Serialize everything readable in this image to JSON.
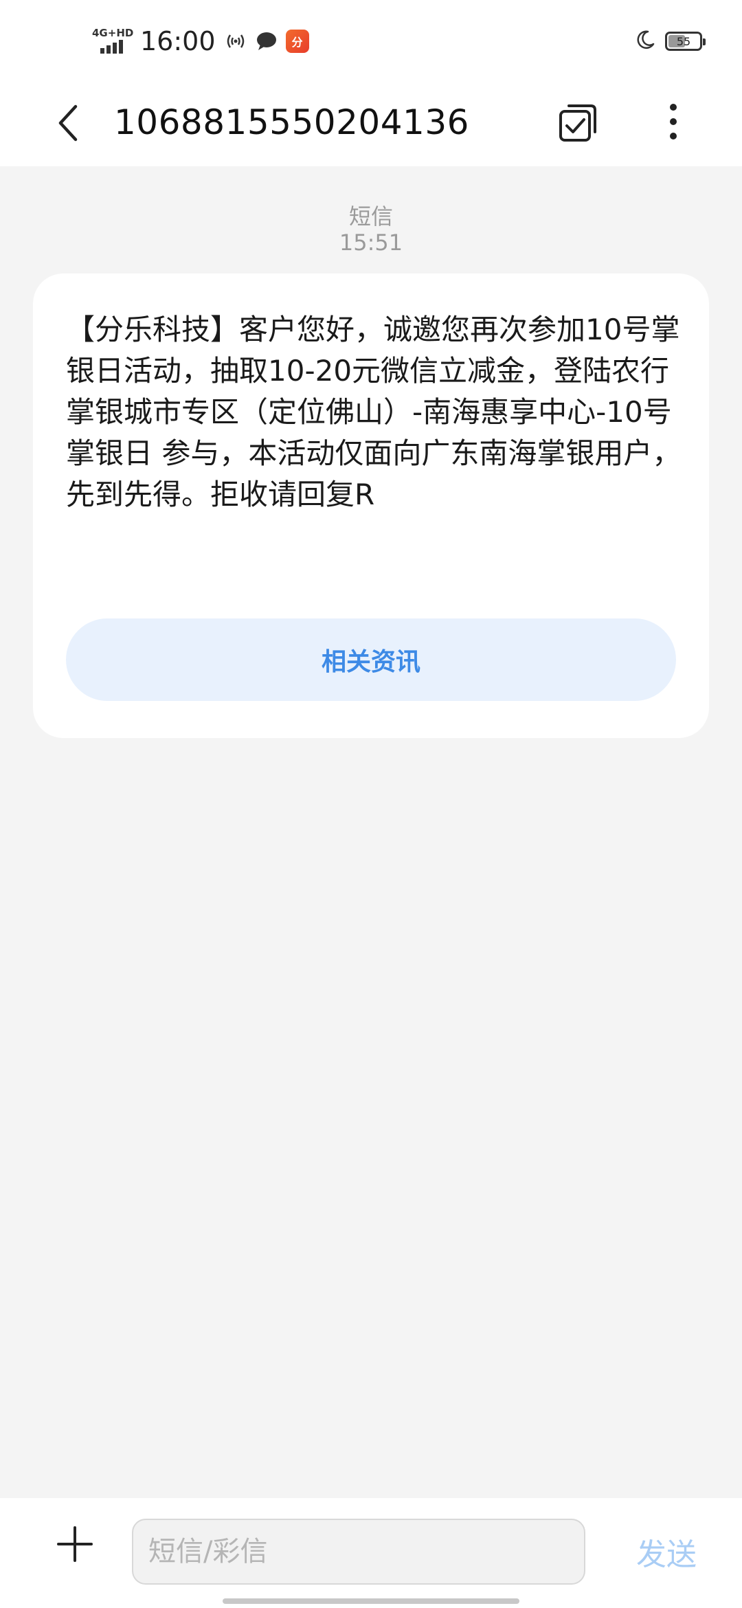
{
  "status_bar": {
    "network": "4G+HD",
    "time": "16:00",
    "app_badge": "分",
    "battery": "55",
    "battery_level": 0.55,
    "icons": [
      "signal-icon",
      "hotspot-icon",
      "chat-bubble-icon",
      "app-notification-icon",
      "moon-icon",
      "battery-icon"
    ]
  },
  "header": {
    "title": "1068815550204136",
    "icons": [
      "back-arrow-icon",
      "multi-select-icon",
      "more-vertical-icon"
    ]
  },
  "message": {
    "type_label": "短信",
    "time": "15:51",
    "body": "【分乐科技】客户您好，诚邀您再次参加10号掌银日活动，抽取10-20元微信立减金，登陆农行掌银城市专区（定位佛山）-南海惠享中心-10号掌银日 参与，本活动仅面向广东南海掌银用户，先到先得。拒收请回复R",
    "related_button": "相关资讯"
  },
  "composer": {
    "placeholder": "短信/彩信",
    "send_label": "发送",
    "icons": [
      "plus-icon"
    ]
  },
  "colors": {
    "background": "#f4f4f4",
    "bubble": "#ffffff",
    "accent": "#3d8ae6",
    "related_button_bg": "#e8f1fd",
    "send_disabled": "#a9cdf5",
    "meta_text": "#9a9a9a"
  }
}
